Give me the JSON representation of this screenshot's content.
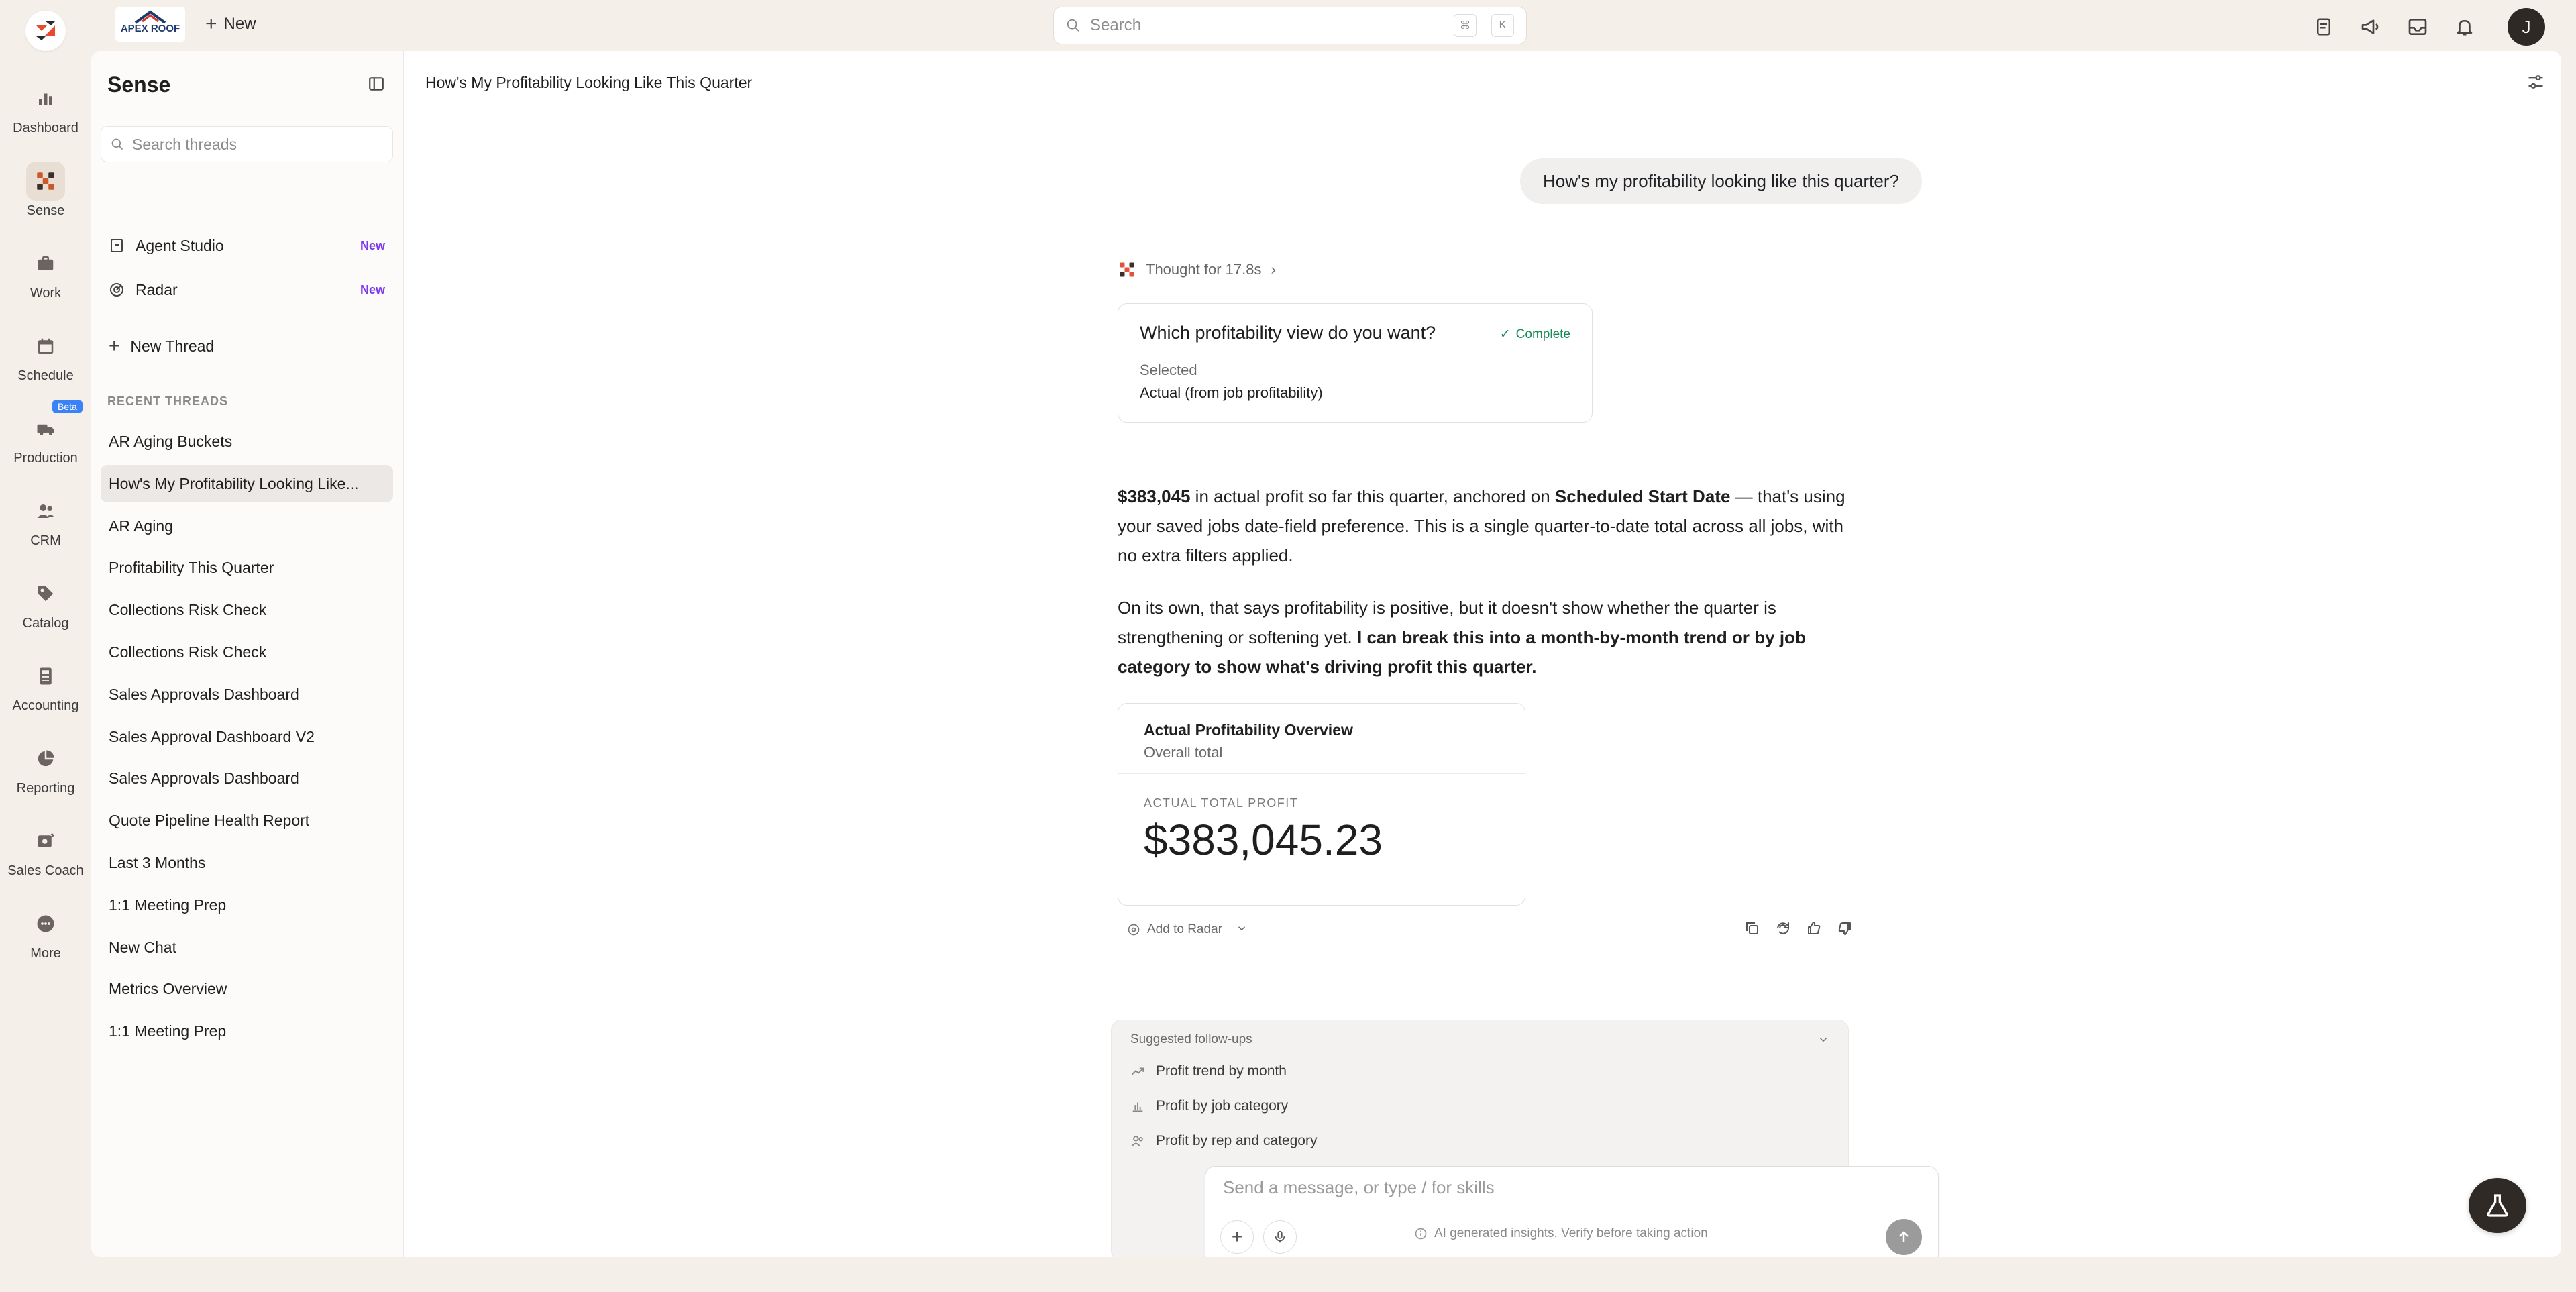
{
  "topbar": {
    "company_logo_text": "APEX ROOF",
    "new_label": "New",
    "search_placeholder": "Search",
    "kbd_cmd": "⌘",
    "kbd_k": "K",
    "avatar_initial": "J"
  },
  "rail": {
    "items": [
      {
        "label": "Dashboard",
        "icon": "bar-chart-icon"
      },
      {
        "label": "Sense",
        "icon": "sense-icon"
      },
      {
        "label": "Work",
        "icon": "briefcase-icon"
      },
      {
        "label": "Schedule",
        "icon": "calendar-icon"
      },
      {
        "label": "Production",
        "icon": "truck-icon",
        "badge": "Beta"
      },
      {
        "label": "CRM",
        "icon": "users-icon"
      },
      {
        "label": "Catalog",
        "icon": "tag-icon"
      },
      {
        "label": "Accounting",
        "icon": "calculator-icon"
      },
      {
        "label": "Reporting",
        "icon": "pie-chart-icon"
      },
      {
        "label": "Sales Coach",
        "icon": "coach-icon"
      },
      {
        "label": "More",
        "icon": "more-icon"
      }
    ]
  },
  "sidebar": {
    "title": "Sense",
    "search_placeholder": "Search threads",
    "links": [
      {
        "label": "Agent Studio",
        "badge": "New"
      },
      {
        "label": "Radar",
        "badge": "New"
      }
    ],
    "new_thread_label": "New Thread",
    "recent_label": "RECENT THREADS",
    "threads": [
      "AR Aging Buckets",
      "How's My Profitability Looking Like...",
      "AR Aging",
      "Profitability This Quarter",
      "Collections Risk Check",
      "Collections Risk Check",
      "Sales Approvals Dashboard",
      "Sales Approval Dashboard V2",
      "Sales Approvals Dashboard",
      "Quote Pipeline Health Report",
      "Last 3 Months",
      "1:1 Meeting Prep",
      "New Chat",
      "Metrics Overview",
      "1:1 Meeting Prep"
    ]
  },
  "chat": {
    "page_title": "How's My Profitability Looking Like This Quarter",
    "user_message": "How's my profitability looking like this quarter?",
    "thought_label": "Thought for 17.8s",
    "question_card": {
      "question": "Which profitability view do you want?",
      "status": "Complete",
      "selected_label": "Selected",
      "selected_value": "Actual (from job profitability)"
    },
    "p1": {
      "bold1": "$383,045",
      "text1": " in actual profit so far this quarter, anchored on ",
      "bold2": "Scheduled Start Date",
      "text2": " — that's using your saved jobs date-field preference. This is a single quarter-to-date total across all jobs, with no extra filters applied."
    },
    "p2": {
      "text": "On its own, that says profitability is positive, but it doesn't show whether the quarter is strengthening or softening yet. ",
      "bold": "I can break this into a month-by-month trend or by job category to show what's driving profit this quarter."
    },
    "stat_card": {
      "title": "Actual Profitability Overview",
      "subtitle": "Overall total",
      "label": "ACTUAL TOTAL PROFIT",
      "value": "$383,045.23"
    },
    "add_to_radar": "Add to Radar",
    "followups": {
      "title": "Suggested follow-ups",
      "items": [
        {
          "label": "Profit trend by month",
          "icon": "trend-icon"
        },
        {
          "label": "Profit by job category",
          "icon": "bar-icon"
        },
        {
          "label": "Profit by rep and category",
          "icon": "people-icon"
        }
      ]
    },
    "composer_placeholder": "Send a message, or type / for skills",
    "disclaimer": "AI generated insights. Verify before taking action"
  }
}
